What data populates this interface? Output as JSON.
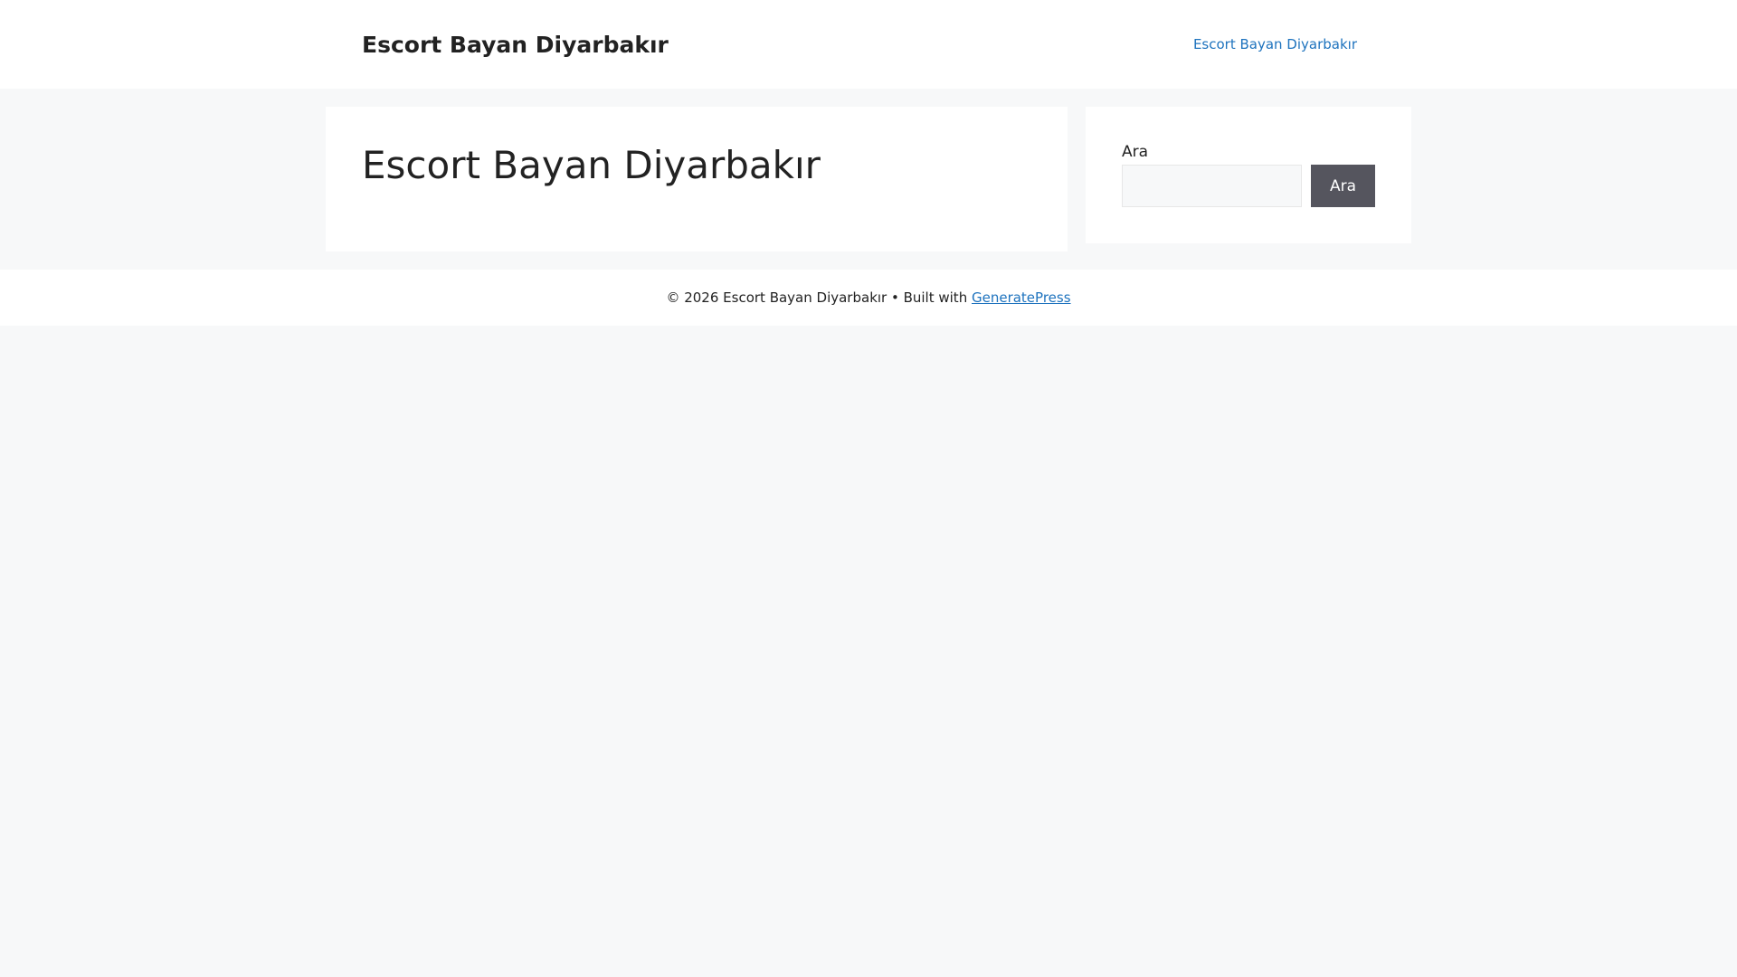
{
  "header": {
    "site_title": "Escort Bayan Diyarbakır",
    "nav": [
      {
        "label": "Escort Bayan Diyarbakır"
      }
    ]
  },
  "main": {
    "title": "Escort Bayan Diyarbakır"
  },
  "sidebar": {
    "search_label": "Ara",
    "search_value": "",
    "search_button": "Ara"
  },
  "footer": {
    "copyright": "© 2026 Escort Bayan Diyarbakır • Built with ",
    "link": "GeneratePress"
  },
  "colors": {
    "link": "#1e73be",
    "button": "#55555e",
    "background": "#f7f8f9"
  }
}
